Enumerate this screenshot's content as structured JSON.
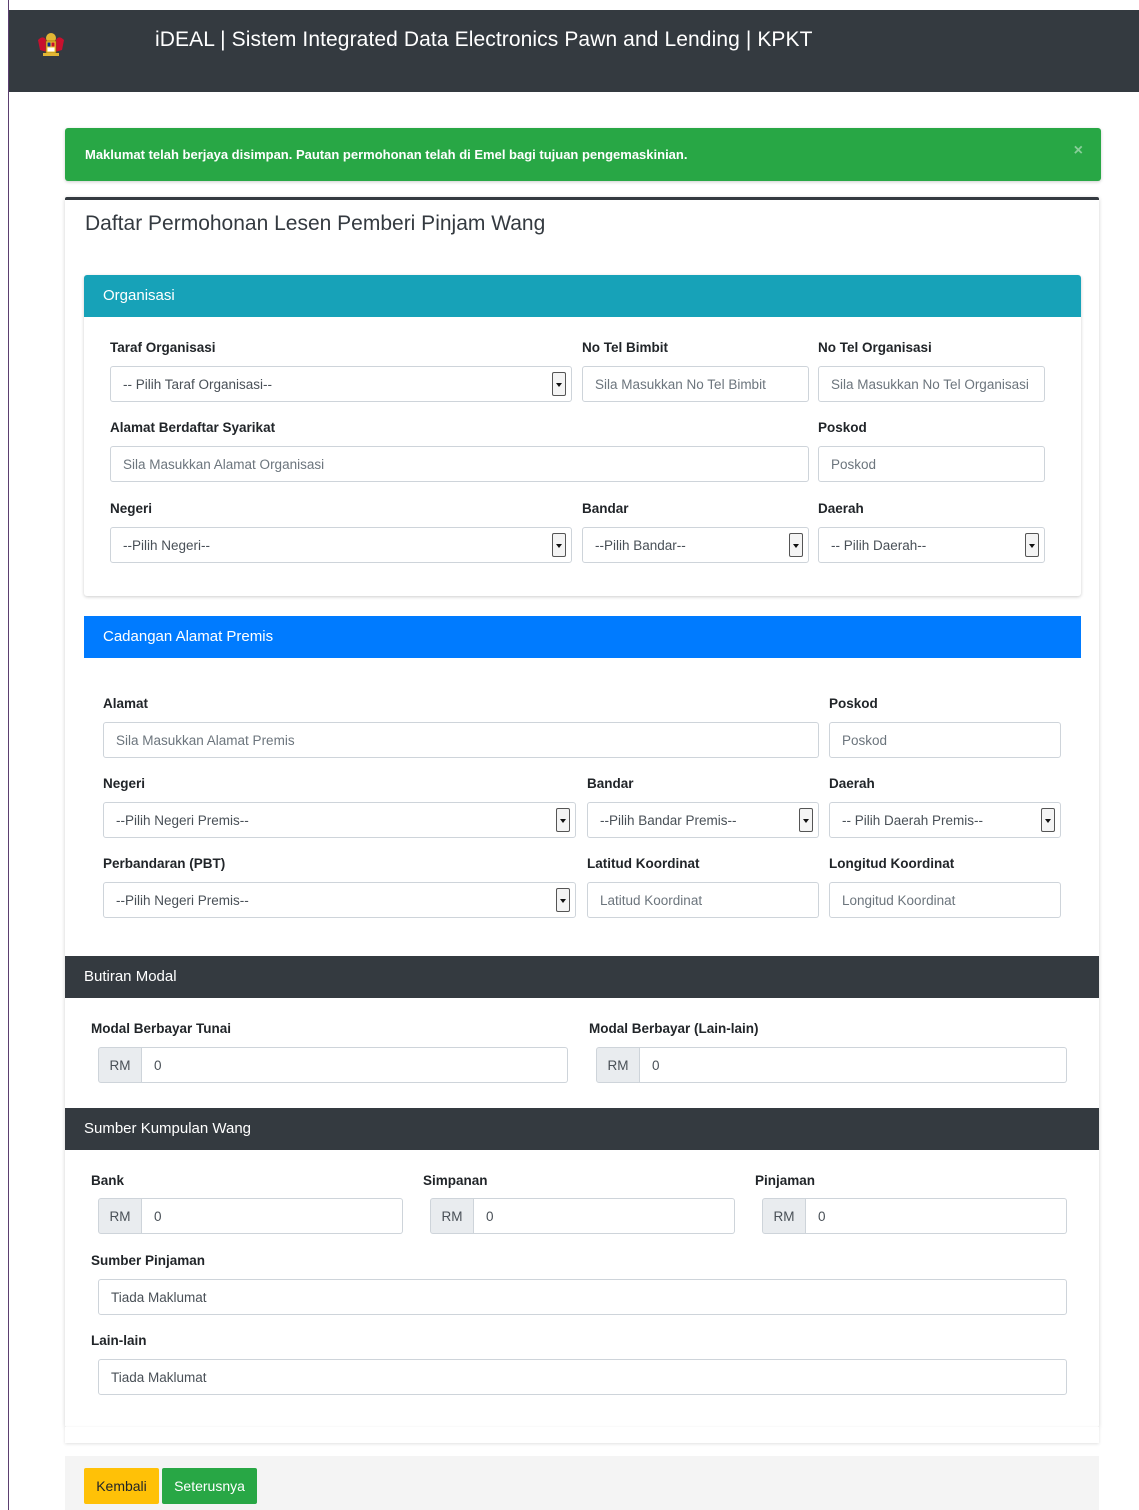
{
  "header": {
    "crest_icon": "malaysia-coat-of-arms",
    "title": "iDEAL | Sistem Integrated Data Electronics Pawn and Lending | KPKT"
  },
  "alert": {
    "message": "Maklumat telah berjaya disimpan. Pautan permohonan telah di Emel bagi tujuan pengemaskinian.",
    "close": "×"
  },
  "page_title": "Daftar Permohonan Lesen Pemberi Pinjam Wang",
  "organisasi": {
    "heading": "Organisasi",
    "taraf_label": "Taraf Organisasi",
    "taraf_value": "-- Pilih Taraf Organisasi--",
    "tel_bimbit_label": "No Tel Bimbit",
    "tel_bimbit_placeholder": "Sila Masukkan No Tel Bimbit",
    "tel_org_label": "No Tel Organisasi",
    "tel_org_placeholder": "Sila Masukkan No Tel Organisasi",
    "alamat_label": "Alamat Berdaftar Syarikat",
    "alamat_placeholder": "Sila Masukkan Alamat Organisasi",
    "poskod_label": "Poskod",
    "poskod_placeholder": "Poskod",
    "negeri_label": "Negeri",
    "negeri_value": "--Pilih Negeri--",
    "bandar_label": "Bandar",
    "bandar_value": "--Pilih Bandar--",
    "daerah_label": "Daerah",
    "daerah_value": "-- Pilih Daerah--"
  },
  "premis": {
    "heading": "Cadangan Alamat Premis",
    "alamat_label": "Alamat",
    "alamat_placeholder": "Sila Masukkan Alamat Premis",
    "poskod_label": "Poskod",
    "poskod_placeholder": "Poskod",
    "negeri_label": "Negeri",
    "negeri_value": "--Pilih Negeri Premis--",
    "bandar_label": "Bandar",
    "bandar_value": "--Pilih Bandar Premis--",
    "daerah_label": "Daerah",
    "daerah_value": "-- Pilih Daerah Premis--",
    "pbt_label": "Perbandaran (PBT)",
    "pbt_value": "--Pilih Negeri Premis--",
    "latitud_label": "Latitud Koordinat",
    "latitud_placeholder": "Latitud Koordinat",
    "longitud_label": "Longitud Koordinat",
    "longitud_placeholder": "Longitud Koordinat"
  },
  "modal": {
    "heading": "Butiran Modal",
    "tunai_label": "Modal Berbayar Tunai",
    "lain_label": "Modal Berbayar (Lain-lain)",
    "currency": "RM",
    "tunai_value": "0",
    "lain_value": "0"
  },
  "sumber": {
    "heading": "Sumber Kumpulan Wang",
    "bank_label": "Bank",
    "simpanan_label": "Simpanan",
    "pinjaman_label": "Pinjaman",
    "currency": "RM",
    "bank_value": "0",
    "simpanan_value": "0",
    "pinjaman_value": "0",
    "sumber_pinjaman_label": "Sumber Pinjaman",
    "sumber_pinjaman_value": "Tiada Maklumat",
    "lain_label": "Lain-lain",
    "lain_value": "Tiada Maklumat"
  },
  "buttons": {
    "back": "Kembali",
    "next": "Seterusnya"
  },
  "colors": {
    "navbar": "#343a40",
    "success": "#28a745",
    "info": "#17a2b8",
    "primary": "#007bff",
    "warning": "#ffc107"
  }
}
